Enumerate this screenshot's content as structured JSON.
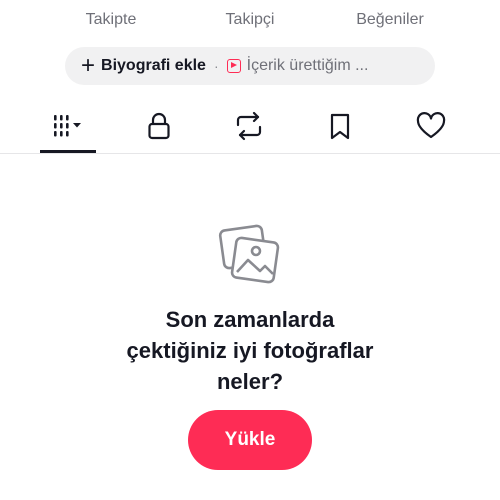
{
  "stats": [
    {
      "label": "Takipte"
    },
    {
      "label": "Takipçi"
    },
    {
      "label": "Beğeniler"
    }
  ],
  "bio_chip": {
    "add_bio_label": "Biyografi ekle",
    "separator": "·",
    "content_label": "İçerik ürettiğim ..."
  },
  "tabs": [
    {
      "name": "videos",
      "icon": "grid-icon",
      "selected": true
    },
    {
      "name": "private",
      "icon": "lock-icon",
      "selected": false
    },
    {
      "name": "reposts",
      "icon": "repost-icon",
      "selected": false
    },
    {
      "name": "favorites",
      "icon": "bookmark-icon",
      "selected": false
    },
    {
      "name": "liked",
      "icon": "heart-icon",
      "selected": false
    }
  ],
  "empty_state": {
    "icon": "photos-icon",
    "title_line1": "Son zamanlarda",
    "title_line2": "çektiğiniz iyi fotoğraflar",
    "title_line3": "neler?",
    "button_label": "Yükle"
  },
  "colors": {
    "accent": "#fe2c55",
    "text_primary": "#161823",
    "text_secondary": "#6f7078",
    "chip_bg": "#f1f1f2"
  }
}
